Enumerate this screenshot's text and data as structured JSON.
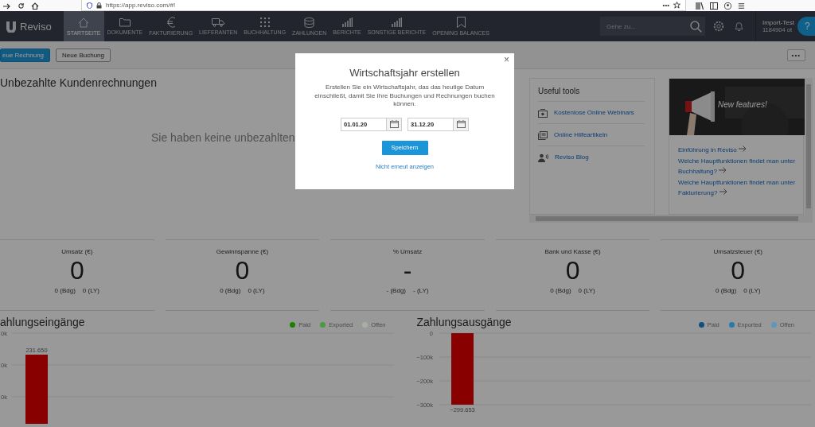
{
  "browser": {
    "url": "https://app.reviso.com/#!",
    "menu": "•••"
  },
  "app": {
    "logo": "Reviso"
  },
  "nav": [
    {
      "label": "STARTSEITE",
      "kind": "home",
      "selected": true
    },
    {
      "label": "DOKUMENTE",
      "kind": "folder",
      "selected": false
    },
    {
      "label": "FAKTURIERUNG",
      "kind": "euro",
      "selected": false
    },
    {
      "label": "LIEFERANTEN",
      "kind": "truck",
      "selected": false
    },
    {
      "label": "BUCHHALTUNG",
      "kind": "grid",
      "selected": false
    },
    {
      "label": "ZAHLUNGEN",
      "kind": "coins",
      "selected": false
    },
    {
      "label": "BERICHTE",
      "kind": "bars",
      "selected": false
    },
    {
      "label": "SONSTIGE BERICHTE",
      "kind": "bars",
      "selected": false
    },
    {
      "label": "OPENING BALANCES",
      "kind": "bookmark",
      "selected": false
    }
  ],
  "search": {
    "placeholder": "Gehe zu..."
  },
  "user": {
    "name": "Import-Test",
    "account": "1184904 ot"
  },
  "help": "?",
  "toolbar": {
    "buttons": [
      {
        "label": "eue Rechnung",
        "kind": "primary"
      },
      {
        "label": "Neue Buchung",
        "kind": "secondary"
      }
    ],
    "more": "•••"
  },
  "unpaid": {
    "title": "Unbezahlte Kundenrechnungen",
    "empty_message": "Sie haben keine unbezahlten"
  },
  "useful_tools": {
    "title": "Useful tools",
    "links": [
      {
        "label": "Kostenlose Online Webinars",
        "kind": "video"
      },
      {
        "label": "Online Hilfeartikeln",
        "kind": "articles"
      },
      {
        "label": "Reviso Blog",
        "kind": "speaker"
      }
    ]
  },
  "news": {
    "banner": {
      "kind": "picture",
      "caption": "New features!"
    },
    "links": [
      {
        "label": "Einführung in Reviso"
      },
      {
        "label": "Welche Hauptfunktionen findet man unter Buchhaltung?"
      },
      {
        "label": "Welche Hauptfunktionen findet man unter Fakturierung?"
      }
    ]
  },
  "kpis": [
    {
      "title": "Umsatz (€)",
      "value": "0",
      "budget": "0 (Bdg)",
      "last_year": "0 (LY)"
    },
    {
      "title": "Gewinnspanne (€)",
      "value": "0",
      "budget": "0 (Bdg)",
      "last_year": "0 (LY)"
    },
    {
      "title": "% Umsatz",
      "value": "-",
      "budget": "- (Bdg)",
      "last_year": "- (LY)"
    },
    {
      "title": "Bank und Kasse (€)",
      "value": "0",
      "budget": "0 (Bdg)",
      "last_year": "0 (LY)"
    },
    {
      "title": "Umsatzsteuer (€)",
      "value": "0",
      "budget": "0 (Bdg)",
      "last_year": "0 (LY)"
    }
  ],
  "charts": [
    {
      "title": "ahlungseingänge",
      "legend": [
        {
          "name": "Paid",
          "color": "#1a8000"
        },
        {
          "name": "Exported",
          "color": "#4a9a40"
        },
        {
          "name": "Offen",
          "color": "#a8b0a5"
        }
      ],
      "axis_labels": [
        "0k",
        "0k",
        "0k"
      ],
      "bar_label": "231.650"
    },
    {
      "title": "Zahlungsausgänge",
      "legend": [
        {
          "name": "Paid",
          "color": "#0f4f80"
        },
        {
          "name": "Exported",
          "color": "#2a78b0"
        },
        {
          "name": "Offen",
          "color": "#5a98c0"
        }
      ],
      "chart_data": {
        "type": "bar",
        "values": [
          -299653
        ],
        "value_labels": [
          "−299.653"
        ],
        "ylim": [
          -300000,
          0
        ],
        "yticks": [
          {
            "value": 0,
            "label": "0"
          },
          {
            "value": -100000,
            "label": "−100k"
          },
          {
            "value": -200000,
            "label": "−200k"
          },
          {
            "value": -300000,
            "label": "−300k"
          }
        ]
      }
    }
  ],
  "modal": {
    "title": "Wirtschaftsjahr erstellen",
    "text": "Erstellen Sie ein Wirtschaftsjahr, das das heutige Datum einschließt, damit Sie Ihre Buchungen und Rechnungen buchen können.",
    "from": "01.01.20",
    "to": "31.12.20",
    "save": "Speichern",
    "dismiss": "Nicht erneut anzeigen",
    "close": "×"
  }
}
